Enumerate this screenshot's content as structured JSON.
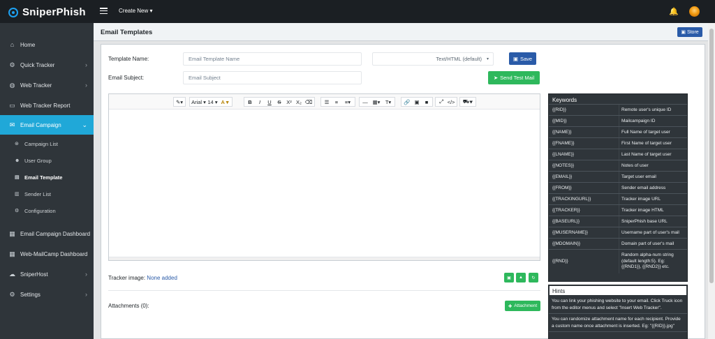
{
  "app": {
    "brand": "SniperPhish"
  },
  "topbar": {
    "create_new": "Create New ▾"
  },
  "sidebar": {
    "items": [
      {
        "label": "Home",
        "icon": "home-icon",
        "glyph": "⌂"
      },
      {
        "label": "Quick Tracker",
        "icon": "quick-tracker-icon",
        "glyph": "⚙"
      },
      {
        "label": "Web Tracker",
        "icon": "globe-icon",
        "glyph": "◍"
      },
      {
        "label": "Web Tracker Report",
        "icon": "laptop-icon",
        "glyph": "▭"
      },
      {
        "label": "Email Campaign",
        "icon": "envelope-icon",
        "glyph": "✉"
      },
      {
        "label": "Email Campaign Dashboard",
        "icon": "dashboard-icon",
        "glyph": "▦"
      },
      {
        "label": "Web-MailCamp Dashboard",
        "icon": "dashboard-icon",
        "glyph": "▦"
      },
      {
        "label": "SniperHost",
        "icon": "cloud-icon",
        "glyph": "☁"
      },
      {
        "label": "Settings",
        "icon": "gear-icon",
        "glyph": "⚙"
      }
    ],
    "subitems": [
      {
        "label": "Campaign List",
        "icon": "list-icon",
        "glyph": "⊛"
      },
      {
        "label": "User Group",
        "icon": "users-icon",
        "glyph": "☻"
      },
      {
        "label": "Email Template",
        "icon": "template-icon",
        "glyph": "▤"
      },
      {
        "label": "Sender List",
        "icon": "sender-icon",
        "glyph": "▥"
      },
      {
        "label": "Configuration",
        "icon": "gear-icon",
        "glyph": "⚙"
      }
    ]
  },
  "page": {
    "title": "Email Templates",
    "store_label": "Store",
    "template_name_label": "Template Name:",
    "template_name_placeholder": "Email Template Name",
    "email_subject_label": "Email Subject:",
    "email_subject_placeholder": "Email Subject",
    "format_select": "Text/HTML (default)",
    "save_label": "Save",
    "send_test_label": "Send Test Mail",
    "tracker_label": "Tracker image:",
    "tracker_value": "None added",
    "attachments_label": "Attachments (0):",
    "attachment_button": "Attachment"
  },
  "toolbar": {
    "font_name": "Arial",
    "font_size": "14",
    "groups": [
      [
        "✎▾"
      ],
      [
        "Arial ▾",
        "14 ▾",
        "A ▾"
      ],
      [
        "B",
        "I",
        "U",
        "S",
        "X²",
        "X₂",
        "⌫"
      ],
      [
        "☰",
        "≡",
        "≡▾"
      ],
      [
        "—",
        "▦▾",
        "T▾"
      ],
      [
        "🔗",
        "▣",
        "■"
      ],
      [
        "⤢",
        "</>"
      ],
      [
        "⛟▾"
      ]
    ]
  },
  "keywords": {
    "title": "Keywords",
    "rows": [
      {
        "key": "{{RID}}",
        "desc": "Remote user's unique ID"
      },
      {
        "key": "{{MID}}",
        "desc": "Mailcampaign ID"
      },
      {
        "key": "{{NAME}}",
        "desc": "Full Name of target user"
      },
      {
        "key": "{{FNAME}}",
        "desc": "First Name of target user"
      },
      {
        "key": "{{LNAME}}",
        "desc": "Last Name of target user"
      },
      {
        "key": "{{NOTES}}",
        "desc": "Notes of user"
      },
      {
        "key": "{{EMAIL}}",
        "desc": "Target user email"
      },
      {
        "key": "{{FROM}}",
        "desc": "Sender email address"
      },
      {
        "key": "{{TRACKINGURL}}",
        "desc": "Tracker image URL"
      },
      {
        "key": "{{TRACKER}}",
        "desc": "Tracker image HTML"
      },
      {
        "key": "{{BASEURL}}",
        "desc": "SniperPhish base URL"
      },
      {
        "key": "{{MUSERNAME}}",
        "desc": "Username part of user's mail"
      },
      {
        "key": "{{MDOMAIN}}",
        "desc": "Domain part of user's mail"
      },
      {
        "key": "{{RND}}",
        "desc": "Random alpha-num string (default length:5). Eg: {{RND1}}, {{RND2}} etc."
      }
    ]
  },
  "hints": {
    "title": "Hints",
    "items": [
      "You can link your phishing website to your email. Click Truck icon from the editor menus and select \"Insert Web Tracker\".",
      "You can randomize attachment name for each recipient. Provide a custom name once attachment is inserted. Eg: \"{{RID}}.jpg\""
    ]
  },
  "colors": {
    "accent": "#20a8d8",
    "primary": "#2a5ba8",
    "success": "#2eb85c",
    "sidebar": "#2f353a"
  }
}
